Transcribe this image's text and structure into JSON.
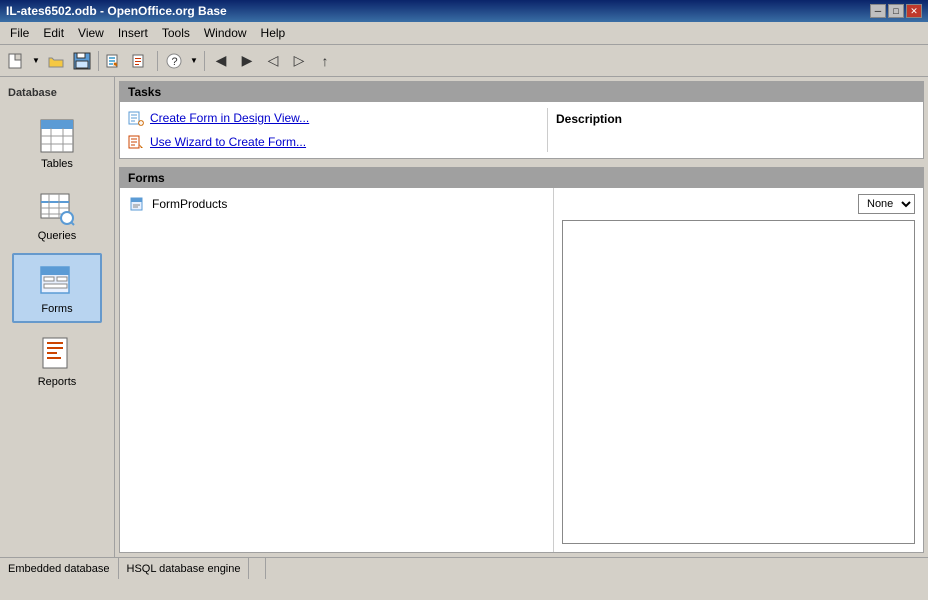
{
  "window": {
    "title": "IL-ates6502.odb - OpenOffice.org Base",
    "controls": [
      "minimize",
      "maximize",
      "close"
    ]
  },
  "menu": {
    "items": [
      "File",
      "Edit",
      "View",
      "Insert",
      "Tools",
      "Window",
      "Help"
    ]
  },
  "toolbar": {
    "buttons": [
      "new",
      "open",
      "save",
      "print",
      "undo",
      "redo",
      "wizard-form",
      "wizard-report",
      "nav-prev",
      "nav-next"
    ]
  },
  "sidebar": {
    "section_label": "Database",
    "items": [
      {
        "id": "tables",
        "label": "Tables",
        "active": false
      },
      {
        "id": "queries",
        "label": "Queries",
        "active": false
      },
      {
        "id": "forms",
        "label": "Forms",
        "active": true
      },
      {
        "id": "reports",
        "label": "Reports",
        "active": false
      }
    ]
  },
  "tasks": {
    "section_label": "Tasks",
    "items": [
      {
        "label": "Create Form in Design View...",
        "id": "create-design"
      },
      {
        "label": "Use Wizard to Create Form...",
        "id": "use-wizard"
      }
    ],
    "description": {
      "label": "Description"
    }
  },
  "forms": {
    "section_label": "Forms",
    "items": [
      {
        "label": "FormProducts",
        "id": "form-products",
        "selected": false
      }
    ],
    "preview": {
      "dropdown_value": "None"
    }
  },
  "status_bar": {
    "embedded_label": "Embedded database",
    "engine_label": "HSQL database engine"
  }
}
